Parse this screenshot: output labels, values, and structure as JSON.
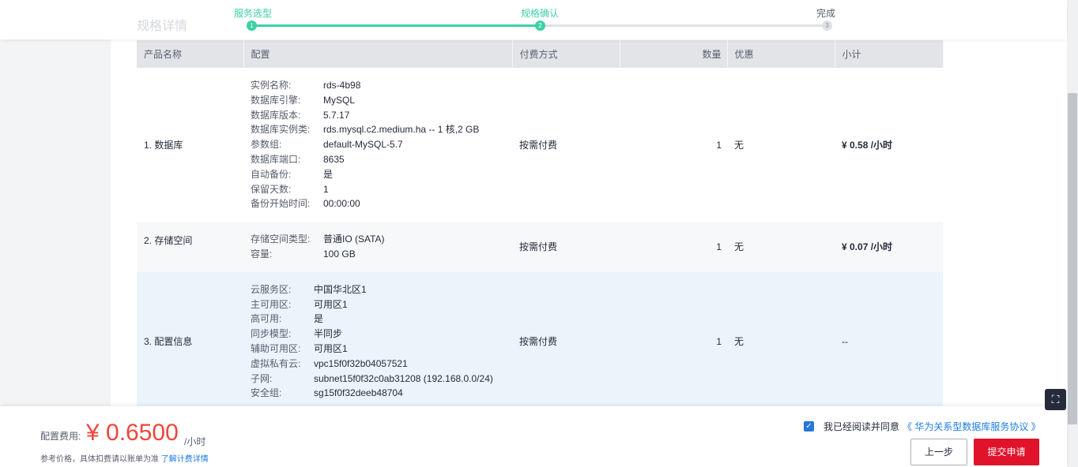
{
  "header": {
    "section_title": "规格详情",
    "steps": [
      {
        "label": "服务选型",
        "num": "1"
      },
      {
        "label": "规格确认",
        "num": "2"
      },
      {
        "label": "完成",
        "num": "3"
      }
    ]
  },
  "table": {
    "columns": [
      "产品名称",
      "配置",
      "付费方式",
      "数量",
      "优惠",
      "小计"
    ],
    "rows": [
      {
        "name": "1. 数据库",
        "config": [
          {
            "k": "实例名称:",
            "v": "rds-4b98"
          },
          {
            "k": "数据库引擎:",
            "v": "MySQL"
          },
          {
            "k": "数据库版本:",
            "v": "5.7.17"
          },
          {
            "k": "数据库实例类:",
            "v": "rds.mysql.c2.medium.ha -- 1 核,2 GB"
          },
          {
            "k": "参数组:",
            "v": "default-MySQL-5.7"
          },
          {
            "k": "数据库端口:",
            "v": "8635"
          },
          {
            "k": "自动备份:",
            "v": "是"
          },
          {
            "k": "保留天数:",
            "v": "1"
          },
          {
            "k": "备份开始时间:",
            "v": "00:00:00"
          }
        ],
        "billing": "按需付费",
        "qty": "1",
        "discount": "无",
        "subtotal": "¥ 0.58 /小时"
      },
      {
        "name": "2. 存储空间",
        "config": [
          {
            "k": "存储空间类型:",
            "v": "普通IO (SATA)"
          },
          {
            "k": "容量:",
            "v": "100 GB"
          }
        ],
        "billing": "按需付费",
        "qty": "1",
        "discount": "无",
        "subtotal": "¥ 0.07 /小时"
      },
      {
        "name": "3. 配置信息",
        "config": [
          {
            "k": "云服务区:",
            "v": "中国华北区1"
          },
          {
            "k": "主可用区:",
            "v": "可用区1"
          },
          {
            "k": "高可用:",
            "v": "是"
          },
          {
            "k": "同步模型:",
            "v": "半同步"
          },
          {
            "k": "辅助可用区:",
            "v": "可用区1"
          },
          {
            "k": "虚拟私有云:",
            "v": "vpc15f0f32b04057521"
          },
          {
            "k": "子网:",
            "v": "subnet15f0f32c0ab31208 (192.168.0.0/24)"
          },
          {
            "k": "安全组:",
            "v": "sg15f0f32deeb48704"
          }
        ],
        "billing": "按需付费",
        "qty": "1",
        "discount": "无",
        "subtotal": "--"
      }
    ]
  },
  "footer": {
    "fee_label": "配置费用:",
    "fee_amount": "¥ 0.6500",
    "fee_unit": "/小时",
    "note": "参考价格，具体扣费请以账单为准",
    "note_link": "了解计费详情",
    "agree_text": "我已经阅读并同意",
    "agree_link": "《 华为关系型数据库服务协议 》",
    "prev_label": "上一步",
    "submit_label": "提交申请"
  },
  "colors": {
    "accent_green": "#3ed0a7",
    "price_red": "#e1132b",
    "link_blue": "#1e7be5"
  }
}
